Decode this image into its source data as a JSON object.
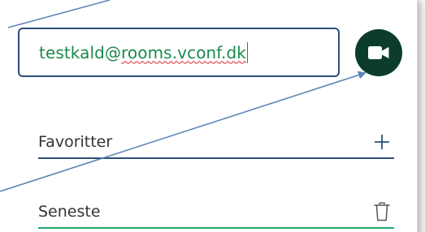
{
  "address_input": {
    "value_prefix": "testkald@",
    "value_misspelled": "rooms.vconf.dk"
  },
  "call_button": {
    "icon": "video-camera-icon"
  },
  "favorites": {
    "label": "Favoritter",
    "action_icon": "plus-icon"
  },
  "recent": {
    "label": "Seneste",
    "action_icon": "trash-icon"
  },
  "colors": {
    "input_border": "#2c4f78",
    "input_text": "#1a8a4a",
    "call_button": "#0b3d2a",
    "favorites_rule": "#2c4f78",
    "recent_rule": "#1aa567",
    "annotation_arrow": "#5b86b8"
  }
}
